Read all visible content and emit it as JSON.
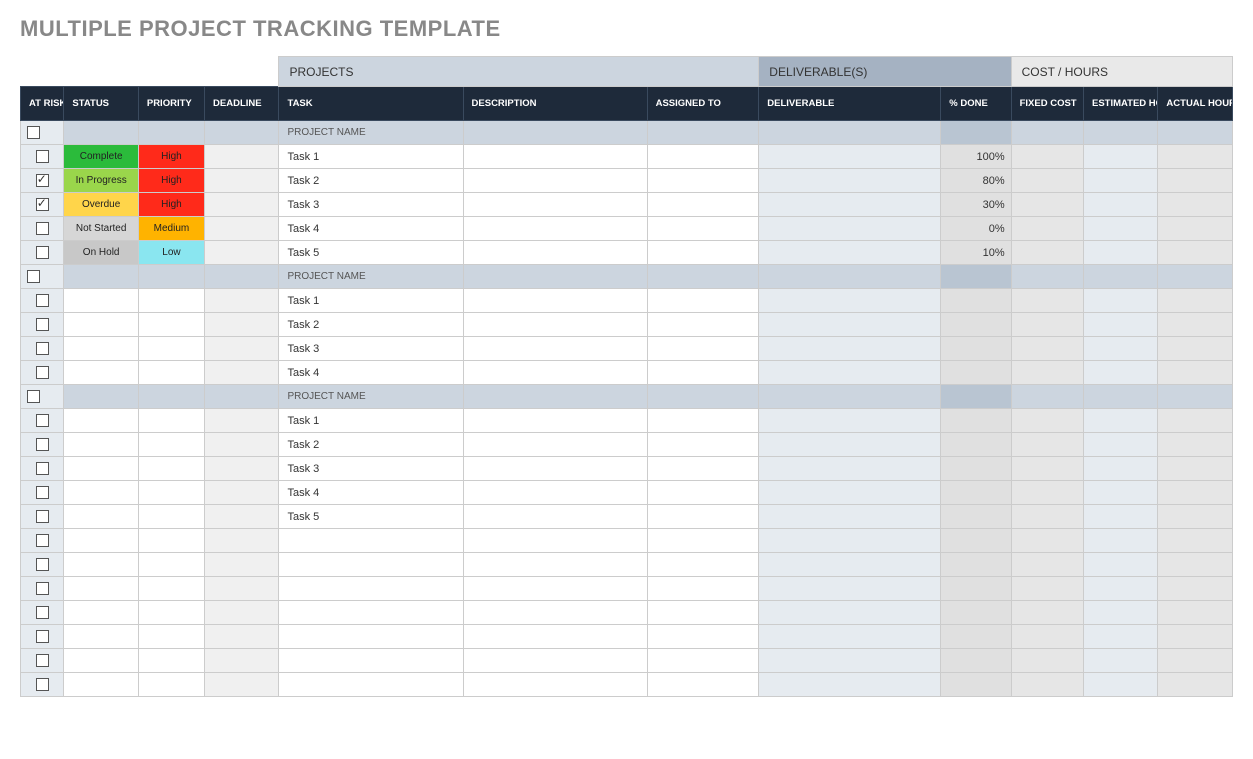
{
  "title": "MULTIPLE PROJECT TRACKING TEMPLATE",
  "groupHeaders": {
    "projects": "PROJECTS",
    "deliverables": "DELIVERABLE(S)",
    "cost": "COST / HOURS"
  },
  "columns": {
    "atrisk": "AT RISK",
    "status": "STATUS",
    "priority": "PRIORITY",
    "deadline": "DEADLINE",
    "task": "TASK",
    "description": "DESCRIPTION",
    "assigned": "ASSIGNED TO",
    "deliverable": "DELIVERABLE",
    "pctdone": "% DONE",
    "fixedcost": "FIXED COST",
    "esthours": "ESTIMATED HOURS",
    "actualhours": "ACTUAL HOURS"
  },
  "rows": [
    {
      "type": "project",
      "task": "PROJECT NAME"
    },
    {
      "type": "task",
      "atrisk": false,
      "status": "Complete",
      "statusClass": "st-complete",
      "priority": "High",
      "priorityClass": "pr-high",
      "task": "Task 1",
      "pct": "100%"
    },
    {
      "type": "task",
      "atrisk": true,
      "status": "In Progress",
      "statusClass": "st-inprogress",
      "priority": "High",
      "priorityClass": "pr-high",
      "task": "Task 2",
      "pct": "80%"
    },
    {
      "type": "task",
      "atrisk": true,
      "status": "Overdue",
      "statusClass": "st-overdue",
      "priority": "High",
      "priorityClass": "pr-high",
      "task": "Task 3",
      "pct": "30%"
    },
    {
      "type": "task",
      "atrisk": false,
      "status": "Not Started",
      "statusClass": "st-notstarted",
      "priority": "Medium",
      "priorityClass": "pr-medium",
      "task": "Task 4",
      "pct": "0%"
    },
    {
      "type": "task",
      "atrisk": false,
      "status": "On Hold",
      "statusClass": "st-onhold",
      "priority": "Low",
      "priorityClass": "pr-low",
      "task": "Task 5",
      "pct": "10%"
    },
    {
      "type": "project",
      "task": "PROJECT NAME"
    },
    {
      "type": "task",
      "atrisk": false,
      "task": "Task 1"
    },
    {
      "type": "task",
      "atrisk": false,
      "task": "Task 2"
    },
    {
      "type": "task",
      "atrisk": false,
      "task": "Task 3"
    },
    {
      "type": "task",
      "atrisk": false,
      "task": "Task 4"
    },
    {
      "type": "project",
      "task": "PROJECT NAME"
    },
    {
      "type": "task",
      "atrisk": false,
      "task": "Task 1"
    },
    {
      "type": "task",
      "atrisk": false,
      "task": "Task 2"
    },
    {
      "type": "task",
      "atrisk": false,
      "task": "Task 3"
    },
    {
      "type": "task",
      "atrisk": false,
      "task": "Task 4"
    },
    {
      "type": "task",
      "atrisk": false,
      "task": "Task 5"
    },
    {
      "type": "task",
      "atrisk": false
    },
    {
      "type": "task",
      "atrisk": false
    },
    {
      "type": "task",
      "atrisk": false
    },
    {
      "type": "task",
      "atrisk": false
    },
    {
      "type": "task",
      "atrisk": false
    },
    {
      "type": "task",
      "atrisk": false
    },
    {
      "type": "task",
      "atrisk": false
    }
  ]
}
